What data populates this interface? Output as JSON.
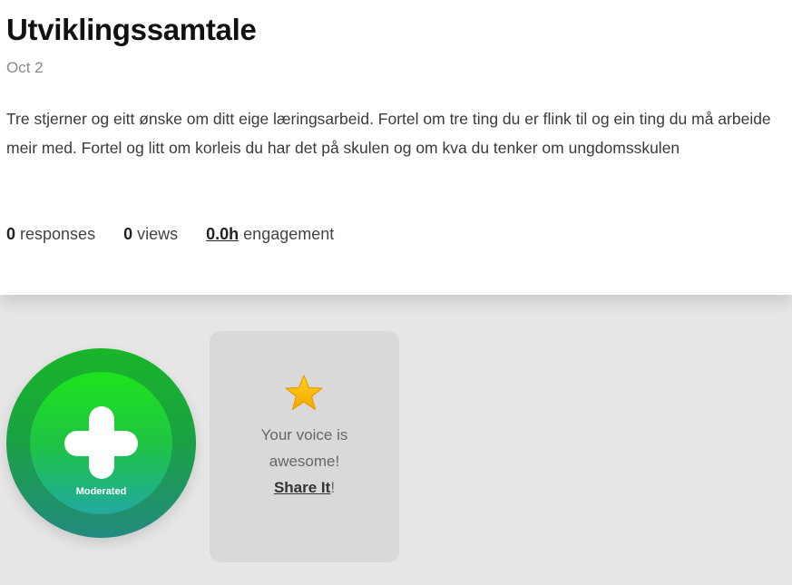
{
  "survey": {
    "title": "Utviklingssamtale",
    "date": "Oct 2",
    "description": "Tre stjerner og eitt ønske om ditt eige læringsarbeid. Fortel om tre ting du er flink til og ein ting du må arbeide meir med. Fortel og litt om korleis du har det på skulen og om kva du tenker om ungdomsskulen"
  },
  "stats": {
    "responses_count": "0",
    "responses_label": " responses",
    "views_count": "0",
    "views_label": " views",
    "engagement_value": "0.0h",
    "engagement_label": " engagement"
  },
  "add_response": {
    "label": "Moderated",
    "icon": "plus-icon",
    "colors": {
      "outer": "#1aa240",
      "inner": "#1ee41c"
    }
  },
  "share": {
    "icon": "star-icon",
    "message": "Your voice is awesome!",
    "link_label": "Share It",
    "suffix": "!"
  }
}
